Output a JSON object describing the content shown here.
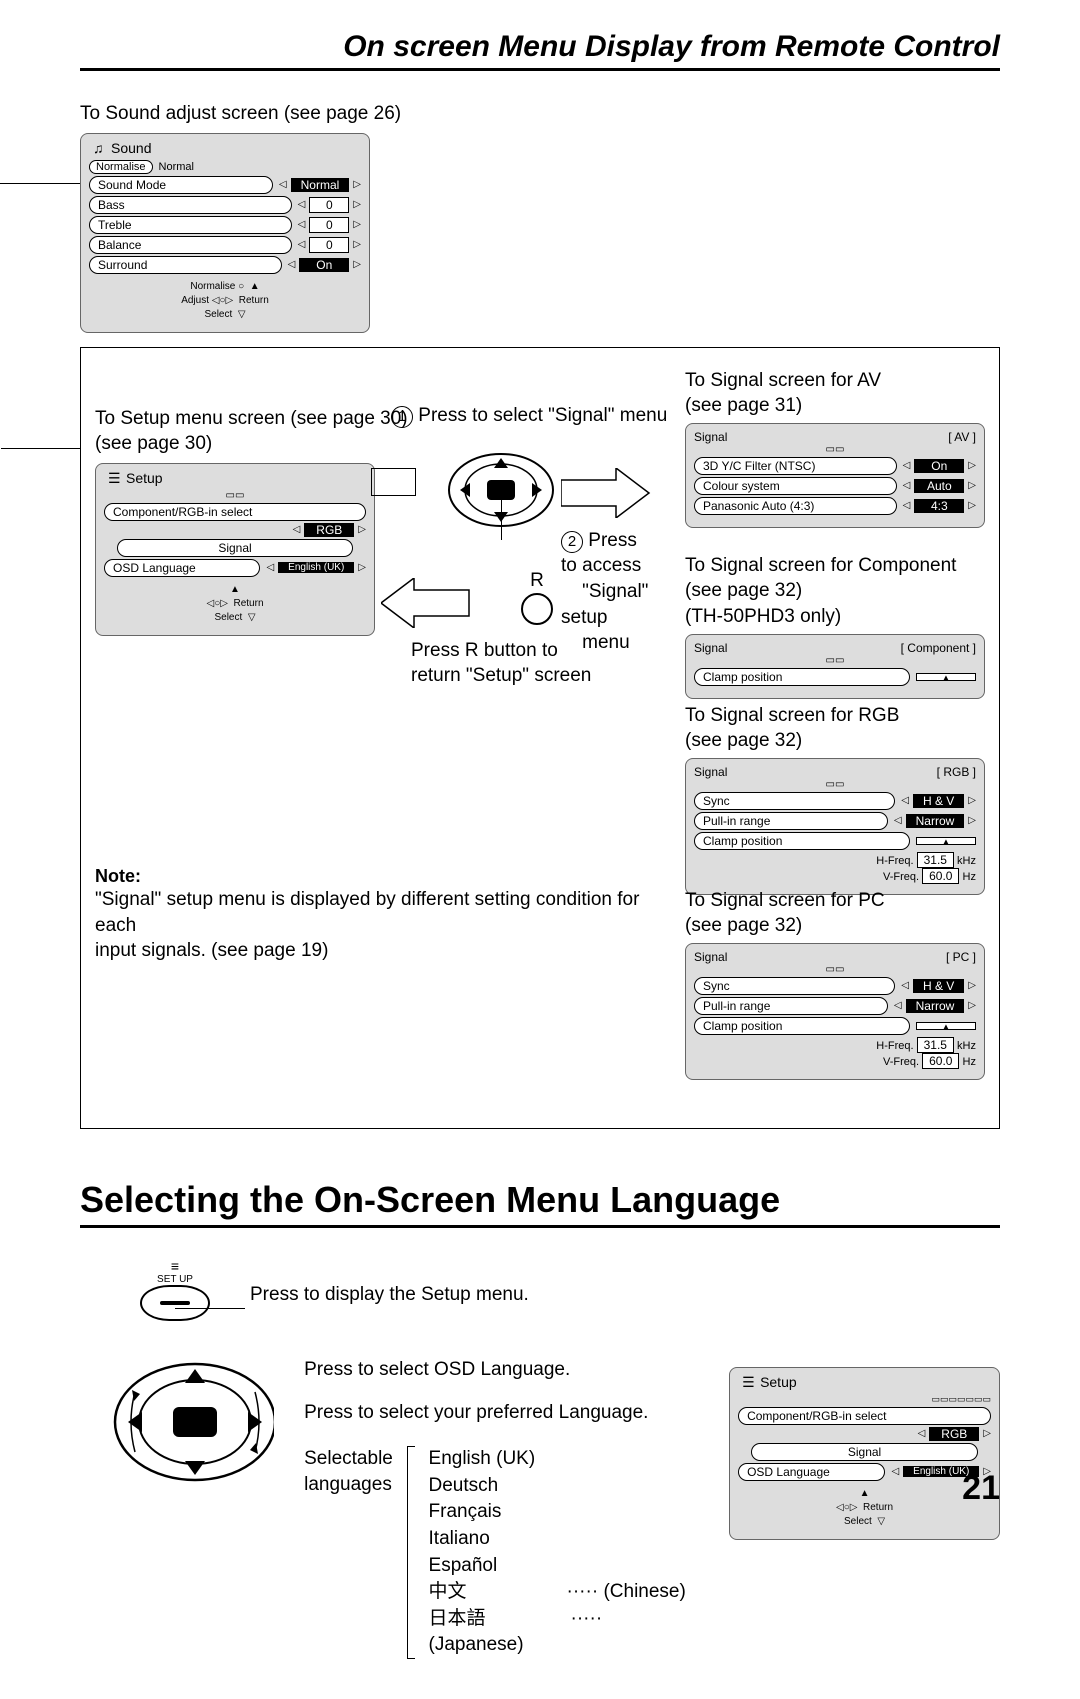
{
  "header": {
    "title": "On screen Menu Display from Remote Control"
  },
  "sound_caption": "To Sound adjust screen (see page 26)",
  "sound_osd": {
    "title": "Sound",
    "normalise_pill": "Normalise",
    "normalise_state": "Normal",
    "rows": [
      {
        "label": "Sound  Mode",
        "value": "Normal",
        "black": true
      },
      {
        "label": "Bass",
        "value": "0",
        "black": false
      },
      {
        "label": "Treble",
        "value": "0",
        "black": false
      },
      {
        "label": "Balance",
        "value": "0",
        "black": false
      },
      {
        "label": "Surround",
        "value": "On",
        "black": true
      }
    ],
    "footer": {
      "normalise": "Normalise",
      "adjust": "Adjust",
      "return": "Return",
      "select": "Select"
    }
  },
  "setup_caption": "To Setup menu screen (see page 30)",
  "setup_osd": {
    "title": "Setup",
    "comp_label": "Component/RGB-in select",
    "comp_value": "RGB",
    "signal_pill": "Signal",
    "osd_lang_label": "OSD  Language",
    "osd_lang_value": "English (UK)",
    "footer_return": "Return",
    "footer_select": "Select"
  },
  "steps": {
    "step1": "Press to select \"Signal\" menu",
    "step2a": "Press to access",
    "step2b": "\"Signal\" setup",
    "step2c": "menu",
    "r_label": "R",
    "return_a": "Press R button to",
    "return_b": "return \"Setup\" screen"
  },
  "signal_av": {
    "caption_a": "To Signal screen for AV",
    "caption_b": "(see page 31)",
    "title": "Signal",
    "tag": "AV",
    "rows": [
      {
        "label": "3D  Y/C  Filter  (NTSC)",
        "value": "On"
      },
      {
        "label": "Colour  system",
        "value": "Auto"
      },
      {
        "label": "Panasonic  Auto  (4:3)",
        "value": "4:3"
      }
    ]
  },
  "signal_comp": {
    "caption_a": "To Signal screen for Component",
    "caption_b": "(see page 32)",
    "caption_c": "(TH-50PHD3 only)",
    "title": "Signal",
    "tag": "Component",
    "clamp_label": "Clamp  position"
  },
  "signal_rgb": {
    "caption_a": "To Signal screen for RGB",
    "caption_b": "(see page 32)",
    "title": "Signal",
    "tag": "RGB",
    "sync_label": "Sync",
    "sync_value": "H & V",
    "pull_label": "Pull-in  range",
    "pull_value": "Narrow",
    "clamp_label": "Clamp  position",
    "hfreq_label": "H-Freq.",
    "hfreq_value": "31.5",
    "hfreq_unit": "kHz",
    "vfreq_label": "V-Freq.",
    "vfreq_value": "60.0",
    "vfreq_unit": "Hz"
  },
  "signal_pc": {
    "caption_a": "To Signal screen for PC",
    "caption_b": "(see page 32)",
    "title": "Signal",
    "tag": "PC",
    "sync_label": "Sync",
    "sync_value": "H & V",
    "pull_label": "Pull-in  range",
    "pull_value": "Narrow",
    "clamp_label": "Clamp  position",
    "hfreq_label": "H-Freq.",
    "hfreq_value": "31.5",
    "hfreq_unit": "kHz",
    "vfreq_label": "V-Freq.",
    "vfreq_value": "60.0",
    "vfreq_unit": "Hz"
  },
  "note": {
    "label": "Note:",
    "text1": "\"Signal\" setup menu is displayed by different setting condition for each",
    "text2": "input signals. (see page 19)"
  },
  "section2": {
    "title": "Selecting the On-Screen Menu Language",
    "setup_btn": "SET UP",
    "step_a": "Press to display the Setup menu.",
    "step_b": "Press to select OSD Language.",
    "step_c": "Press to select your preferred Language.",
    "selectable_a": "Selectable",
    "selectable_b": "languages",
    "langs": [
      "English (UK)",
      "Deutsch",
      "Français",
      "Italiano",
      "Español",
      "中文",
      "日本語"
    ],
    "chinese_note": "(Chinese)",
    "japanese_note": "(Japanese)",
    "dots": "·····"
  },
  "setup_osd2": {
    "title": "Setup",
    "comp_label": "Component/RGB-in select",
    "comp_value": "RGB",
    "signal_pill": "Signal",
    "osd_lang_label": "OSD  Language",
    "osd_lang_value": "English (UK)",
    "footer_return": "Return",
    "footer_select": "Select"
  },
  "page_number": "21"
}
